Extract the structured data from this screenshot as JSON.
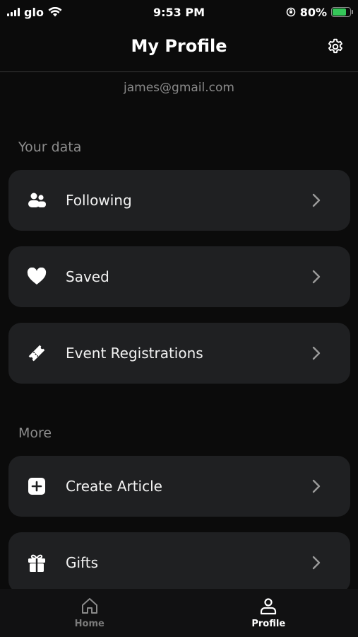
{
  "status_bar": {
    "carrier": "glo",
    "time": "9:53 PM",
    "battery_text": "80%",
    "battery_level": 0.8,
    "battery_color": "#35c759"
  },
  "header": {
    "title": "My Profile",
    "settings_icon": "gear-icon"
  },
  "profile": {
    "email": "james@gmail.com"
  },
  "sections": {
    "your_data": {
      "label": "Your data",
      "items": [
        {
          "label": "Following",
          "icon": "users-icon"
        },
        {
          "label": "Saved",
          "icon": "heart-icon"
        },
        {
          "label": "Event Registrations",
          "icon": "ticket-icon"
        }
      ]
    },
    "more": {
      "label": "More",
      "items": [
        {
          "label": "Create Article",
          "icon": "plus-square-icon"
        },
        {
          "label": "Gifts",
          "icon": "gift-icon"
        }
      ]
    }
  },
  "tab_bar": {
    "tabs": [
      {
        "label": "Home",
        "icon": "home-icon",
        "active": false
      },
      {
        "label": "Profile",
        "icon": "person-icon",
        "active": true
      }
    ]
  }
}
